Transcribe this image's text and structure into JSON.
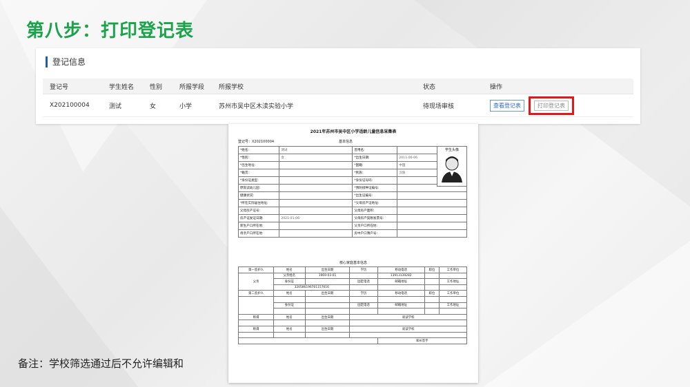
{
  "slide": {
    "title": "第八步：打印登记表",
    "note": "备注：学校筛选通过后不允许编辑和"
  },
  "panel": {
    "header": "登记信息",
    "columns": [
      "登记号",
      "学生姓名",
      "性别",
      "所报学段",
      "所报学校",
      "状态",
      "操作"
    ],
    "row": {
      "reg_no": "X202100004",
      "name": "测试",
      "gender": "女",
      "stage": "小学",
      "school": "苏州市吴中区木渎实验小学",
      "status": "待现场审核",
      "view_label": "查看登记表",
      "print_label": "打印登记表"
    }
  },
  "form": {
    "title": "2021年苏州市吴中区小学适龄儿童信息采集表",
    "reg_no": "登记号：X202100004",
    "basic_title": "基本信息",
    "photo_label": "学生头像",
    "rows": [
      [
        "*姓名:",
        "测试",
        "曾用名:",
        ""
      ],
      [
        "*性别:",
        "女",
        "*出生日期:",
        "2011-06-06"
      ],
      [
        "*出生地址:",
        "",
        "*国籍:",
        "中国"
      ],
      [
        "*籍贯:",
        "",
        "*民族:",
        "汉族"
      ],
      [
        "*身份证类型:",
        "",
        "*身份证号码:",
        ""
      ],
      [
        "原就读幼儿园:",
        "",
        "*预防接种证编号:",
        ""
      ],
      [
        "健康状况:",
        "",
        "*出生证编号:",
        ""
      ],
      [
        "*所在实际居住地址:",
        "",
        "*父母房产证地址:",
        ""
      ],
      [
        "父母房产证号:",
        "",
        "父母房产面积:",
        ""
      ],
      [
        "房产证发证日期:",
        "2021-01-06",
        "父母房产契税发票号:",
        ""
      ],
      [
        "新生户口所在地:",
        "",
        "父亲户口所在地:",
        ""
      ],
      [
        "母亲户口所在地:",
        "",
        "房中户口簿户号:",
        ""
      ]
    ],
    "family_title": "核心家庭基本信息",
    "guardian1": "第一监护人",
    "guardian2": "第二监护人",
    "fam_cols": [
      "姓名",
      "出生日期",
      "学历",
      "移动电话",
      "职位",
      "工作单位"
    ],
    "father": "父亲",
    "father_name": "父亲姓名",
    "father_birth": "1969-03-01",
    "father_phone": "13913139282",
    "id_label": "身份证",
    "fixed_phone": "固定电话",
    "email": "邮箱地址",
    "work_addr": "工作地址",
    "father_id": "320586196701157616",
    "title_label": "称谓",
    "school_col": "就读学校",
    "parent_sign": "家长签字"
  }
}
